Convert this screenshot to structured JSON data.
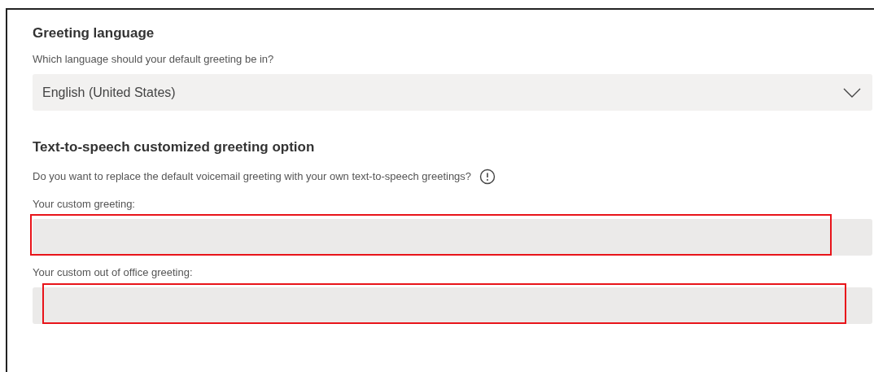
{
  "language_section": {
    "heading": "Greeting language",
    "description": "Which language should your default greeting be in?",
    "dropdown": {
      "value": "English (United States)"
    }
  },
  "tts_section": {
    "heading": "Text-to-speech customized greeting option",
    "description": "Do you want to replace the default voicemail greeting with your own text-to-speech greetings?",
    "fields": [
      {
        "label": "Your custom greeting:",
        "highlighted": true
      },
      {
        "label": "Your custom out of office greeting:",
        "highlighted": true
      }
    ]
  }
}
